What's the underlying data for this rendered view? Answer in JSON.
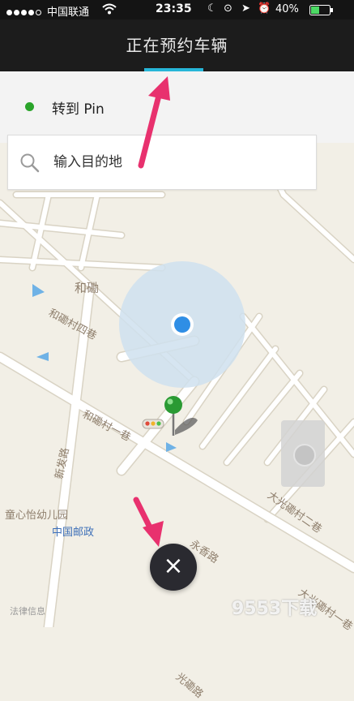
{
  "status_bar": {
    "carrier": "中国联通",
    "time": "23:35",
    "battery": "40%"
  },
  "header": {
    "title": "正在预约车辆"
  },
  "pickup": {
    "label": "转到 Pin",
    "dot_color": "#2aa42a"
  },
  "destination": {
    "placeholder": "输入目的地"
  },
  "map": {
    "labels": {
      "area_hecao": "和磡",
      "road_hecao_4": "和磡村四巷",
      "road_hecao_1": "和磡村一巷",
      "road_xinfa": "新发路",
      "kindergarten": "童心怡幼儿园",
      "post_office": "中国邮政",
      "road_yongxiang": "永香路",
      "road_daguang_2": "大光磡村二巷",
      "road_daguang_1": "大光磡村一巷",
      "road_guang": "光磡路"
    },
    "legal": "法律信息"
  },
  "buttons": {
    "close": "×"
  },
  "watermark": "9553下载"
}
